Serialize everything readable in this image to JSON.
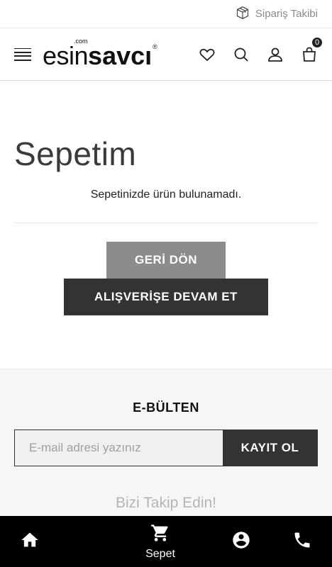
{
  "topbar": {
    "track_label": "Sipariş Takibi"
  },
  "header": {
    "logo_prefix": ".com",
    "logo_main": "esin",
    "logo_bold": "savcı",
    "logo_reg": "®",
    "cart_count": "0"
  },
  "main": {
    "title": "Sepetim",
    "empty_message": "Sepetinizde ürün bulunamadı.",
    "back_button": "GERİ DÖN",
    "continue_button": "ALIŞVERİŞE DEVAM ET"
  },
  "newsletter": {
    "title": "E-BÜLTEN",
    "placeholder": "E-mail adresi yazınız",
    "submit_label": "KAYIT OL",
    "follow_title": "Bizi Takip Edin!"
  },
  "bottom_nav": {
    "cart_label": "Sepet"
  },
  "colors": {
    "primary_dark": "#333333",
    "secondary_gray": "#8c8c8c",
    "bottom_nav_bg": "#000000"
  }
}
